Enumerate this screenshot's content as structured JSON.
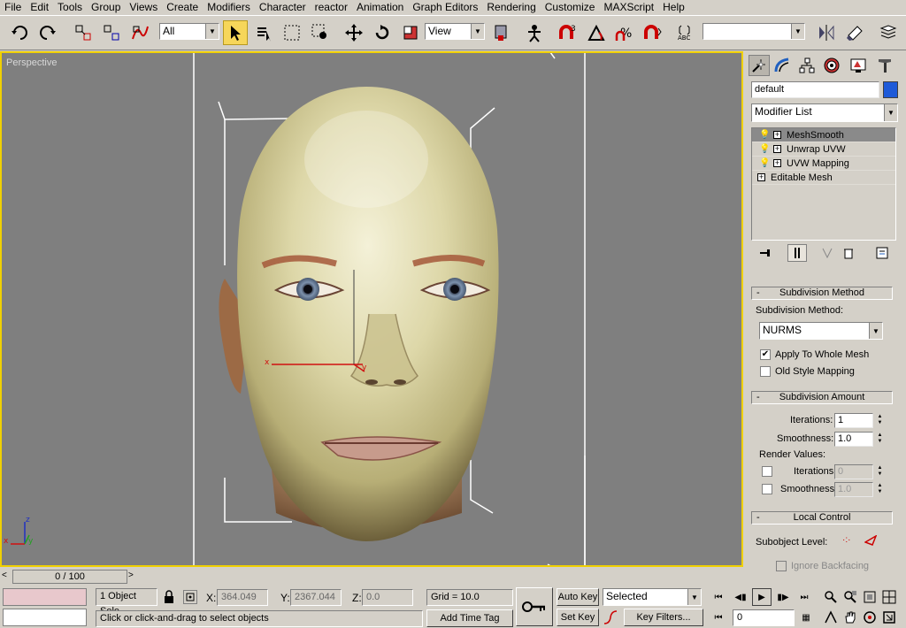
{
  "menu": [
    "File",
    "Edit",
    "Tools",
    "Group",
    "Views",
    "Create",
    "Modifiers",
    "Character",
    "reactor",
    "Animation",
    "Graph Editors",
    "Rendering",
    "Customize",
    "MAXScript",
    "Help"
  ],
  "toolbar": {
    "selection_filter": "All",
    "ref_coord": "View",
    "named_selection": ""
  },
  "viewport": {
    "label": "Perspective"
  },
  "panel": {
    "object_name": "default",
    "object_color": "#1e5ad8",
    "modifier_list": "Modifier List",
    "stack": [
      "MeshSmooth",
      "Unwrap UVW",
      "UVW Mapping",
      "Editable Mesh"
    ],
    "subdivision_method_header": "Subdivision Method",
    "subdivision_method_label": "Subdivision Method:",
    "subdivision_method_value": "NURMS",
    "apply_whole_mesh": "Apply To Whole Mesh",
    "old_style_mapping": "Old Style Mapping",
    "subdivision_amount_header": "Subdivision Amount",
    "iterations_label": "Iterations:",
    "iterations_value": "1",
    "smoothness_label": "Smoothness:",
    "smoothness_value": "1.0",
    "render_values": "Render Values:",
    "render_iterations_label": "Iterations:",
    "render_iterations_value": "0",
    "render_smoothness_label": "Smoothness:",
    "render_smoothness_value": "1.0",
    "local_control_header": "Local Control",
    "subobject_level": "Subobject Level:",
    "ignore_backfacing": "Ignore Backfacing"
  },
  "timeline": {
    "slider": "0 / 100"
  },
  "status": {
    "selection": "1 Object Sele",
    "x_label": "X:",
    "x_value": "364.049",
    "y_label": "Y:",
    "y_value": "2367.044",
    "z_label": "Z:",
    "z_value": "0.0",
    "grid": "Grid = 10.0",
    "prompt": "Click or click-and-drag to select objects",
    "add_time_tag": "Add Time Tag",
    "auto_key": "Auto Key",
    "set_key": "Set Key",
    "selected": "Selected",
    "key_filters": "Key Filters...",
    "frame": "0"
  },
  "colors": {
    "viewport_bg": "#7f7f7f",
    "active_border": "#f0d000",
    "ui_gray": "#d4d0c8"
  }
}
